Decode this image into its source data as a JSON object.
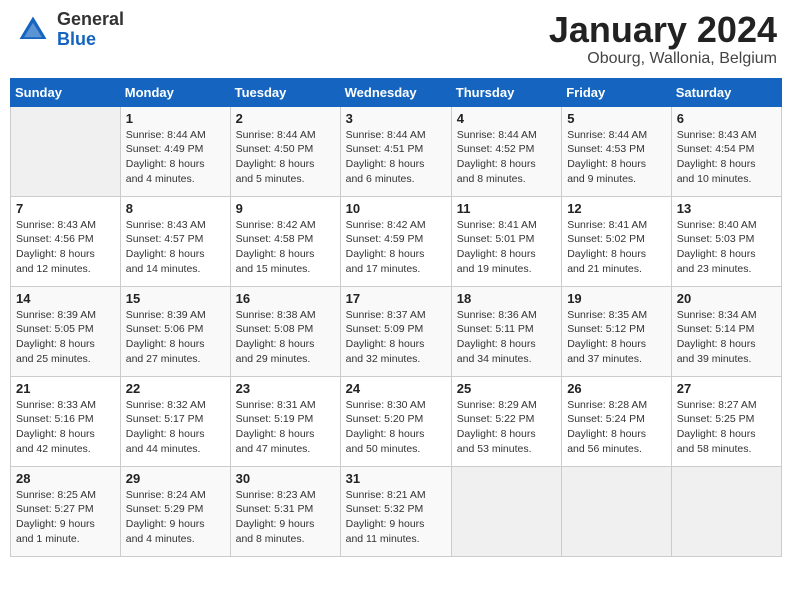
{
  "header": {
    "logo_general": "General",
    "logo_blue": "Blue",
    "month_title": "January 2024",
    "location": "Obourg, Wallonia, Belgium"
  },
  "weekdays": [
    "Sunday",
    "Monday",
    "Tuesday",
    "Wednesday",
    "Thursday",
    "Friday",
    "Saturday"
  ],
  "weeks": [
    [
      {
        "day": "",
        "info": ""
      },
      {
        "day": "1",
        "info": "Sunrise: 8:44 AM\nSunset: 4:49 PM\nDaylight: 8 hours\nand 4 minutes."
      },
      {
        "day": "2",
        "info": "Sunrise: 8:44 AM\nSunset: 4:50 PM\nDaylight: 8 hours\nand 5 minutes."
      },
      {
        "day": "3",
        "info": "Sunrise: 8:44 AM\nSunset: 4:51 PM\nDaylight: 8 hours\nand 6 minutes."
      },
      {
        "day": "4",
        "info": "Sunrise: 8:44 AM\nSunset: 4:52 PM\nDaylight: 8 hours\nand 8 minutes."
      },
      {
        "day": "5",
        "info": "Sunrise: 8:44 AM\nSunset: 4:53 PM\nDaylight: 8 hours\nand 9 minutes."
      },
      {
        "day": "6",
        "info": "Sunrise: 8:43 AM\nSunset: 4:54 PM\nDaylight: 8 hours\nand 10 minutes."
      }
    ],
    [
      {
        "day": "7",
        "info": "Sunrise: 8:43 AM\nSunset: 4:56 PM\nDaylight: 8 hours\nand 12 minutes."
      },
      {
        "day": "8",
        "info": "Sunrise: 8:43 AM\nSunset: 4:57 PM\nDaylight: 8 hours\nand 14 minutes."
      },
      {
        "day": "9",
        "info": "Sunrise: 8:42 AM\nSunset: 4:58 PM\nDaylight: 8 hours\nand 15 minutes."
      },
      {
        "day": "10",
        "info": "Sunrise: 8:42 AM\nSunset: 4:59 PM\nDaylight: 8 hours\nand 17 minutes."
      },
      {
        "day": "11",
        "info": "Sunrise: 8:41 AM\nSunset: 5:01 PM\nDaylight: 8 hours\nand 19 minutes."
      },
      {
        "day": "12",
        "info": "Sunrise: 8:41 AM\nSunset: 5:02 PM\nDaylight: 8 hours\nand 21 minutes."
      },
      {
        "day": "13",
        "info": "Sunrise: 8:40 AM\nSunset: 5:03 PM\nDaylight: 8 hours\nand 23 minutes."
      }
    ],
    [
      {
        "day": "14",
        "info": "Sunrise: 8:39 AM\nSunset: 5:05 PM\nDaylight: 8 hours\nand 25 minutes."
      },
      {
        "day": "15",
        "info": "Sunrise: 8:39 AM\nSunset: 5:06 PM\nDaylight: 8 hours\nand 27 minutes."
      },
      {
        "day": "16",
        "info": "Sunrise: 8:38 AM\nSunset: 5:08 PM\nDaylight: 8 hours\nand 29 minutes."
      },
      {
        "day": "17",
        "info": "Sunrise: 8:37 AM\nSunset: 5:09 PM\nDaylight: 8 hours\nand 32 minutes."
      },
      {
        "day": "18",
        "info": "Sunrise: 8:36 AM\nSunset: 5:11 PM\nDaylight: 8 hours\nand 34 minutes."
      },
      {
        "day": "19",
        "info": "Sunrise: 8:35 AM\nSunset: 5:12 PM\nDaylight: 8 hours\nand 37 minutes."
      },
      {
        "day": "20",
        "info": "Sunrise: 8:34 AM\nSunset: 5:14 PM\nDaylight: 8 hours\nand 39 minutes."
      }
    ],
    [
      {
        "day": "21",
        "info": "Sunrise: 8:33 AM\nSunset: 5:16 PM\nDaylight: 8 hours\nand 42 minutes."
      },
      {
        "day": "22",
        "info": "Sunrise: 8:32 AM\nSunset: 5:17 PM\nDaylight: 8 hours\nand 44 minutes."
      },
      {
        "day": "23",
        "info": "Sunrise: 8:31 AM\nSunset: 5:19 PM\nDaylight: 8 hours\nand 47 minutes."
      },
      {
        "day": "24",
        "info": "Sunrise: 8:30 AM\nSunset: 5:20 PM\nDaylight: 8 hours\nand 50 minutes."
      },
      {
        "day": "25",
        "info": "Sunrise: 8:29 AM\nSunset: 5:22 PM\nDaylight: 8 hours\nand 53 minutes."
      },
      {
        "day": "26",
        "info": "Sunrise: 8:28 AM\nSunset: 5:24 PM\nDaylight: 8 hours\nand 56 minutes."
      },
      {
        "day": "27",
        "info": "Sunrise: 8:27 AM\nSunset: 5:25 PM\nDaylight: 8 hours\nand 58 minutes."
      }
    ],
    [
      {
        "day": "28",
        "info": "Sunrise: 8:25 AM\nSunset: 5:27 PM\nDaylight: 9 hours\nand 1 minute."
      },
      {
        "day": "29",
        "info": "Sunrise: 8:24 AM\nSunset: 5:29 PM\nDaylight: 9 hours\nand 4 minutes."
      },
      {
        "day": "30",
        "info": "Sunrise: 8:23 AM\nSunset: 5:31 PM\nDaylight: 9 hours\nand 8 minutes."
      },
      {
        "day": "31",
        "info": "Sunrise: 8:21 AM\nSunset: 5:32 PM\nDaylight: 9 hours\nand 11 minutes."
      },
      {
        "day": "",
        "info": ""
      },
      {
        "day": "",
        "info": ""
      },
      {
        "day": "",
        "info": ""
      }
    ]
  ]
}
